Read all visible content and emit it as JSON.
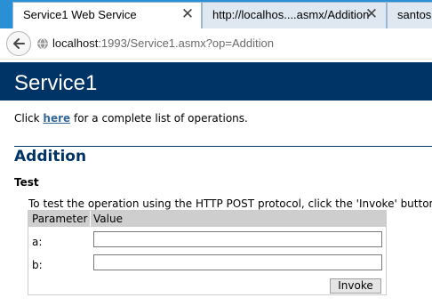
{
  "browser": {
    "tabs": [
      {
        "title": "Service1 Web Service",
        "active": true
      },
      {
        "title": "http://localhos....asmx/Addition",
        "active": false
      },
      {
        "title": "santosh",
        "active": false
      }
    ],
    "url": {
      "host": "localhost",
      "rest": ":1993/Service1.asmx?op=Addition"
    }
  },
  "page": {
    "banner_title": "Service1",
    "intro": {
      "before": "Click ",
      "link": "here",
      "after": " for a complete list of operations."
    },
    "operation_title": "Addition",
    "test_heading": "Test",
    "test_description": "To test the operation using the HTTP POST protocol, click the 'Invoke' button.",
    "table": {
      "header_parameter": "Parameter",
      "header_value": "Value",
      "params": [
        {
          "label": "a:",
          "value": ""
        },
        {
          "label": "b:",
          "value": ""
        }
      ],
      "invoke_label": "Invoke"
    }
  },
  "colors": {
    "tabbar": "#2b8fd6",
    "banner": "#003366",
    "link": "#336699",
    "table_header": "#cecece"
  },
  "icons": [
    "close-icon",
    "back-arrow-icon",
    "globe-icon"
  ]
}
